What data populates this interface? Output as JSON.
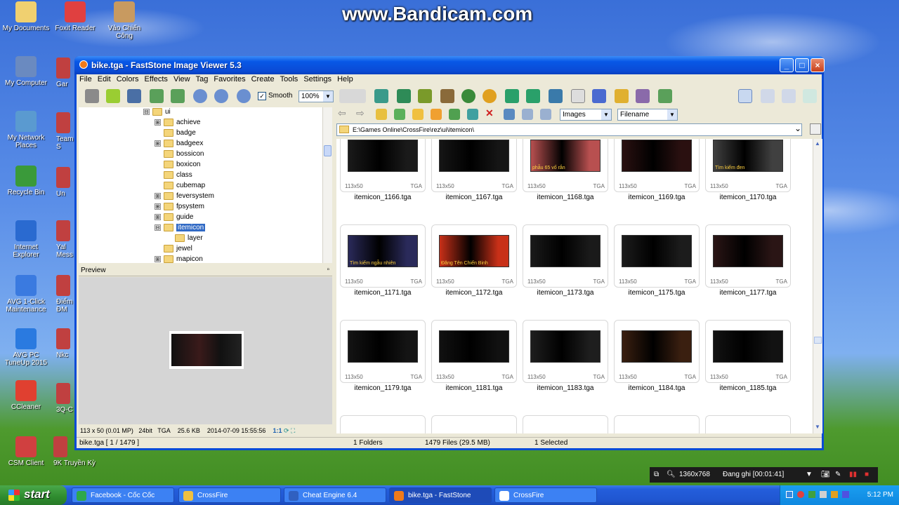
{
  "watermark": "www.Bandicam.com",
  "desktop": {
    "icons": [
      {
        "label": "My Documents"
      },
      {
        "label": "Foxit Reader"
      },
      {
        "label": "Vảo Chiến\nCông"
      },
      {
        "label": "My Computer"
      },
      {
        "label": "My Network\nPlaces"
      },
      {
        "label": "Recycle Bin"
      },
      {
        "label": "Internet\nExplorer"
      },
      {
        "label": "AVG 1-Click\nMaintenance"
      },
      {
        "label": "AVG PC\nTuneUp 2015"
      },
      {
        "label": "CCleaner"
      },
      {
        "label": "CSM Client"
      }
    ],
    "partial_icons": [
      {
        "label": "Gar"
      },
      {
        "label": "Team\nS"
      },
      {
        "label": "Un"
      },
      {
        "label": "Yal\nMess"
      },
      {
        "label": "Điểm\nĐM"
      },
      {
        "label": "Nkc"
      },
      {
        "label": "3Q-C"
      },
      {
        "label": "9K Truyền Kỳ"
      }
    ]
  },
  "window": {
    "title": "bike.tga - FastStone Image Viewer 5.3",
    "controls": {
      "minimize": "_",
      "maximize": "□",
      "close": "×"
    },
    "menu": [
      "File",
      "Edit",
      "Colors",
      "Effects",
      "View",
      "Tag",
      "Favorites",
      "Create",
      "Tools",
      "Settings",
      "Help"
    ],
    "toolbar": {
      "smooth_label": "Smooth",
      "smooth_checked": true,
      "zoom_value": "100%"
    },
    "filter": {
      "type_value": "Images",
      "sort_value": "Filename"
    },
    "path": "E:\\Games Online\\CrossFire\\rez\\ui\\itemicon\\",
    "tree": [
      {
        "label": "ui",
        "expander": "⊟",
        "depth": 0
      },
      {
        "label": "achieve",
        "expander": "⊞",
        "depth": 1
      },
      {
        "label": "badge",
        "expander": "",
        "depth": 1
      },
      {
        "label": "badgeex",
        "expander": "⊞",
        "depth": 1
      },
      {
        "label": "bossicon",
        "expander": "",
        "depth": 1
      },
      {
        "label": "boxicon",
        "expander": "",
        "depth": 1
      },
      {
        "label": "class",
        "expander": "",
        "depth": 1
      },
      {
        "label": "cubemap",
        "expander": "",
        "depth": 1
      },
      {
        "label": "feversystem",
        "expander": "⊞",
        "depth": 1
      },
      {
        "label": "fpsystem",
        "expander": "⊞",
        "depth": 1
      },
      {
        "label": "guide",
        "expander": "⊞",
        "depth": 1
      },
      {
        "label": "itemicon",
        "expander": "⊟",
        "depth": 1,
        "selected": true
      },
      {
        "label": "layer",
        "expander": "",
        "depth": 2
      },
      {
        "label": "jewel",
        "expander": "",
        "depth": 1
      },
      {
        "label": "mapicon",
        "expander": "⊞",
        "depth": 1
      }
    ],
    "preview_label": "Preview",
    "image_info": {
      "dims": "113 x 50 (0.01 MP)",
      "bits": "24bit",
      "format": "TGA",
      "size": "25.6 KB",
      "date": "2014-07-09 15:55:56",
      "ratio": "1:1"
    },
    "thumbnails": [
      {
        "name": "itemicon_1166.tga",
        "dims": "113x50",
        "type": "TGA",
        "tint": "#1a1a1a"
      },
      {
        "name": "itemicon_1167.tga",
        "dims": "113x50",
        "type": "TGA",
        "tint": "#151515"
      },
      {
        "name": "itemicon_1168.tga",
        "dims": "113x50",
        "type": "TGA",
        "tint": "#b85050",
        "caption": "phẫu 65 vố rắn"
      },
      {
        "name": "itemicon_1169.tga",
        "dims": "113x50",
        "type": "TGA",
        "tint": "#2a1010"
      },
      {
        "name": "itemicon_1170.tga",
        "dims": "113x50",
        "type": "TGA",
        "tint": "#404040",
        "caption": "Tìm kiếm đen"
      },
      {
        "name": "itemicon_1171.tga",
        "dims": "113x50",
        "type": "TGA",
        "tint": "#2a2a5a",
        "caption": "Tìm kiếm ngẫu nhiên"
      },
      {
        "name": "itemicon_1172.tga",
        "dims": "113x50",
        "type": "TGA",
        "tint": "#c83018",
        "caption": "Đăng Tên Chiến Binh"
      },
      {
        "name": "itemicon_1173.tga",
        "dims": "113x50",
        "type": "TGA",
        "tint": "#1a1a1a"
      },
      {
        "name": "itemicon_1175.tga",
        "dims": "113x50",
        "type": "TGA",
        "tint": "#1c1c1c"
      },
      {
        "name": "itemicon_1177.tga",
        "dims": "113x50",
        "type": "TGA",
        "tint": "#2a1515"
      },
      {
        "name": "itemicon_1179.tga",
        "dims": "113x50",
        "type": "TGA",
        "tint": "#141414"
      },
      {
        "name": "itemicon_1181.tga",
        "dims": "113x50",
        "type": "TGA",
        "tint": "#111111"
      },
      {
        "name": "itemicon_1183.tga",
        "dims": "113x50",
        "type": "TGA",
        "tint": "#1e1e1e"
      },
      {
        "name": "itemicon_1184.tga",
        "dims": "113x50",
        "type": "TGA",
        "tint": "#3a1f10"
      },
      {
        "name": "itemicon_1185.tga",
        "dims": "113x50",
        "type": "TGA",
        "tint": "#121212"
      }
    ],
    "status": {
      "file": "bike.tga [ 1 / 1479 ]",
      "folders": "1 Folders",
      "files": "1479 Files (29.5 MB)",
      "selected": "1 Selected"
    }
  },
  "bandicam": {
    "resolution": "1360x768",
    "recording": "Đang ghi [00:01:41]"
  },
  "taskbar": {
    "start": "start",
    "tasks": [
      {
        "label": "Facebook - Cốc Cốc",
        "icon_color": "#2ea84a"
      },
      {
        "label": "CrossFire",
        "icon_color": "#f0c040"
      },
      {
        "label": "Cheat Engine 6.4",
        "icon_color": "#3060c0"
      },
      {
        "label": "bike.tga - FastStone",
        "icon_color": "#f07a1a",
        "active": true
      },
      {
        "label": "CrossFire",
        "icon_color": "#ffffff"
      }
    ],
    "clock": "5:12 PM"
  }
}
